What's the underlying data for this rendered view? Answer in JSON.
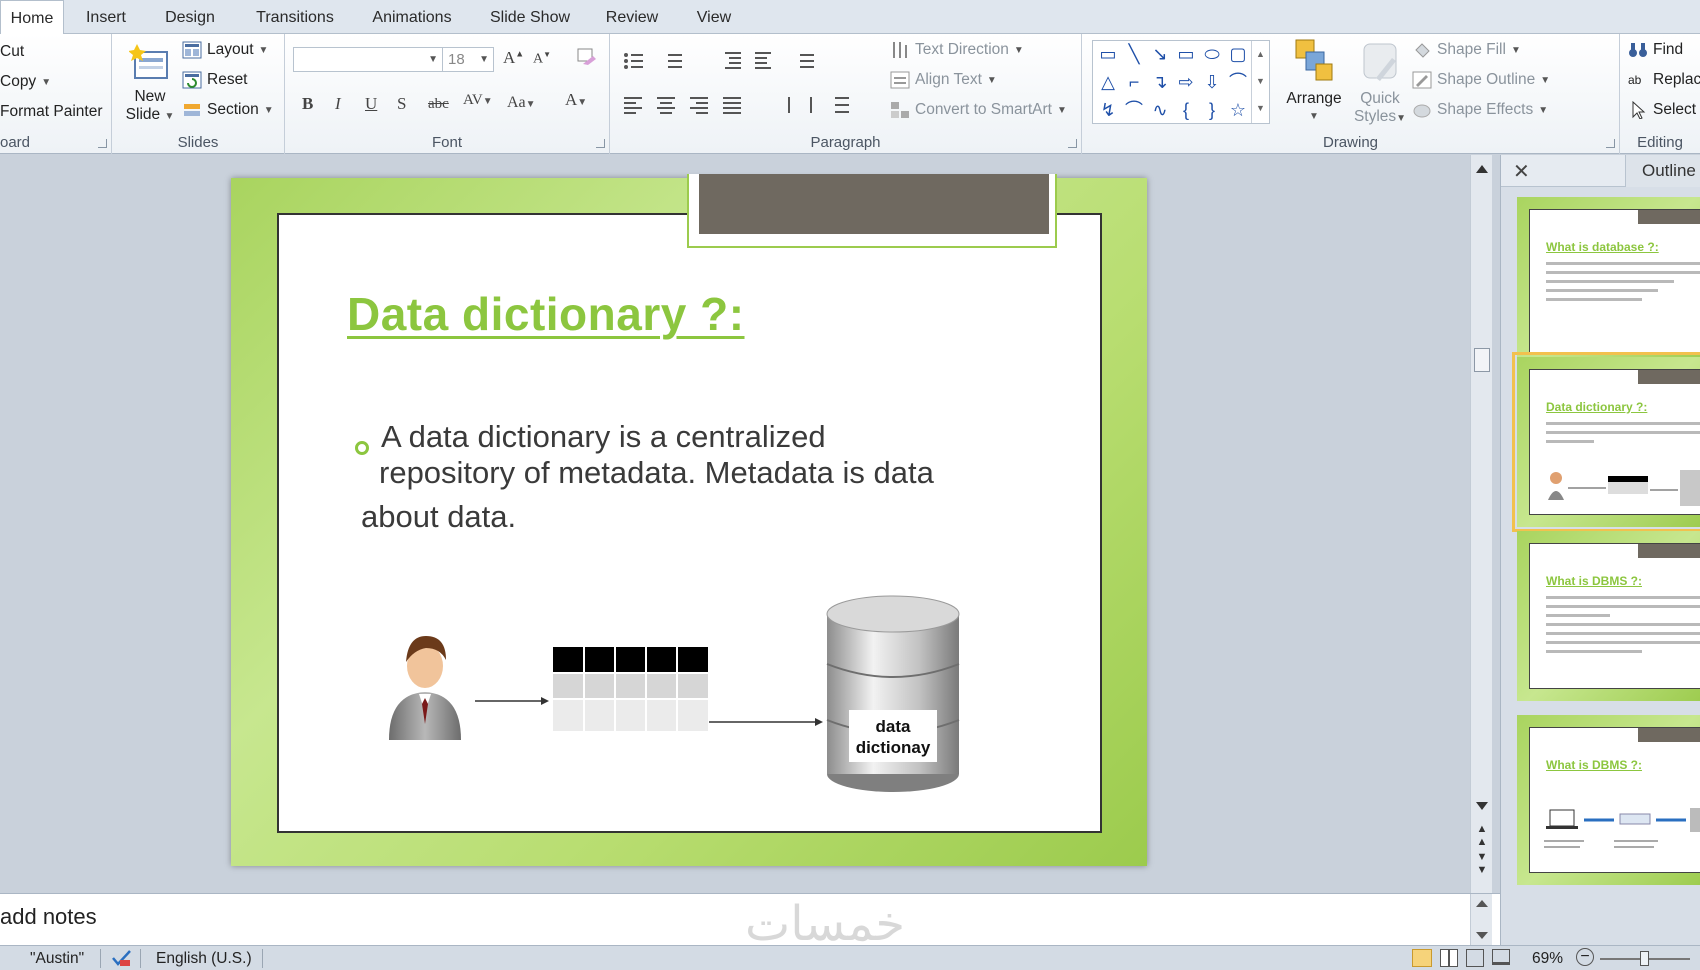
{
  "tabs": [
    "Home",
    "Insert",
    "Design",
    "Transitions",
    "Animations",
    "Slide Show",
    "Review",
    "View"
  ],
  "clipboard": {
    "cut": "Cut",
    "copy": "Copy",
    "format_painter": "Format Painter",
    "label": "oard"
  },
  "slides": {
    "new_slide_1": "New",
    "new_slide_2": "Slide",
    "layout": "Layout",
    "reset": "Reset",
    "section": "Section",
    "label": "Slides"
  },
  "font": {
    "size": "18",
    "label": "Font"
  },
  "paragraph": {
    "text_direction": "Text Direction",
    "align_text": "Align Text",
    "convert": "Convert to SmartArt",
    "label": "Paragraph"
  },
  "drawing": {
    "arrange": "Arrange",
    "quick_1": "Quick",
    "quick_2": "Styles",
    "shape_fill": "Shape Fill",
    "shape_outline": "Shape Outline",
    "shape_effects": "Shape Effects",
    "label": "Drawing"
  },
  "editing": {
    "find": "Find",
    "replace": "Replace",
    "select": "Select",
    "label": "Editing"
  },
  "slide": {
    "title": "Data dictionary ?:",
    "line1": "A data dictionary is a centralized",
    "line2": "repository of metadata. Metadata is data",
    "line3": "about data.",
    "db_label_1": "data",
    "db_label_2": "dictionay"
  },
  "panel": {
    "tab": "Outline"
  },
  "thumbnails": [
    {
      "title": "What is database ?:"
    },
    {
      "title": "Data dictionary ?:"
    },
    {
      "title": "What is DBMS ?:"
    },
    {
      "title": "What is DBMS ?:"
    }
  ],
  "notes": {
    "placeholder": "add notes"
  },
  "watermark": "خمسات",
  "status": {
    "theme": "\"Austin\"",
    "language": "English (U.S.)",
    "zoom": "69%"
  },
  "colors": {
    "accent_green": "#8cc63f",
    "notch": "#6f6960",
    "ribbon_bg": "#ffffff"
  }
}
